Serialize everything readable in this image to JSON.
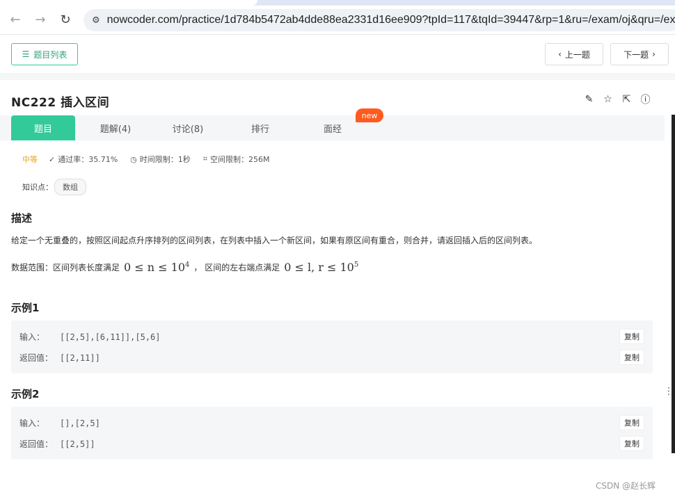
{
  "browser": {
    "url": "nowcoder.com/practice/1d784b5472ab4dde88ea2331d16ee909?tpId=117&tqId=39447&rp=1&ru=/exam/oj&qru=/exam"
  },
  "nav": {
    "list_label": "题目列表",
    "prev_label": "上一题",
    "next_label": "下一题"
  },
  "problem": {
    "title": "NC222  插入区间",
    "difficulty": "中等",
    "pass_rate": "通过率：35.71%",
    "time_limit": "时间限制：1秒",
    "space_limit": "空间限制：256M",
    "knowledge_label": "知识点：",
    "tag": "数组"
  },
  "tabs": [
    {
      "label": "题目"
    },
    {
      "label": "题解(4)"
    },
    {
      "label": "讨论(8)"
    },
    {
      "label": "排行"
    },
    {
      "label": "面经"
    }
  ],
  "badge_new": "new",
  "description": {
    "heading": "描述",
    "text": "给定一个无重叠的，按照区间起点升序排列的区间列表，在列表中插入一个新区间，如果有原区间有重合，则合并，请返回插入后的区间列表。",
    "range_prefix": "数据范围：区间列表长度满足",
    "range_math1": "0 ≤ n ≤ 10",
    "range_math1_exp": "4",
    "range_mid": "，  区间的左右端点满足",
    "range_math2": "0 ≤ l, r ≤ 10",
    "range_math2_exp": "5"
  },
  "examples": [
    {
      "heading": "示例1",
      "input_label": "输入：",
      "input": "[[2,5],[6,11]],[5,6]",
      "output_label": "返回值：",
      "output": "[[2,11]]",
      "copy_label": "复制"
    },
    {
      "heading": "示例2",
      "input_label": "输入：",
      "input": "[],[2,5]",
      "output_label": "返回值：",
      "output": "[[2,5]]",
      "copy_label": "复制"
    }
  ],
  "watermark": "CSDN @赵长辉",
  "colors": {
    "accent": "#32ca99",
    "new_badge": "#ff5a1f",
    "difficulty": "#e8a317"
  }
}
